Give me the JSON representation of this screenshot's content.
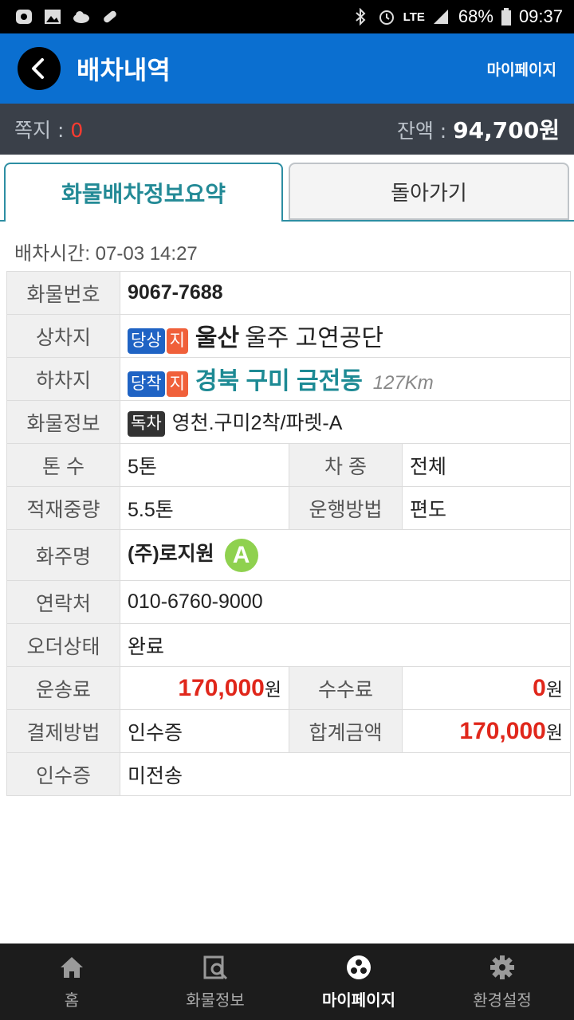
{
  "status_bar": {
    "battery": "68%",
    "time": "09:37",
    "network": "LTE"
  },
  "header": {
    "title": "배차내역",
    "mypage": "마이페이지"
  },
  "info_bar": {
    "note_label": "쪽지 : ",
    "note_count": "0",
    "balance_label": "잔액 : ",
    "balance_value": "94,700원"
  },
  "tabs": {
    "active": "화물배차정보요약",
    "back": "돌아가기"
  },
  "dispatch_time": "배차시간: 07-03 14:27",
  "details": {
    "cargo_no_label": "화물번호",
    "cargo_no": "9067-7688",
    "load_label": "상차지",
    "load_badge1": "당상",
    "load_badge2": "지",
    "load_city": "울산",
    "load_place": "울주 고연공단",
    "unload_label": "하차지",
    "unload_badge1": "당착",
    "unload_badge2": "지",
    "unload_place": "경북 구미 금전동",
    "distance": "127Km",
    "cargo_info_label": "화물정보",
    "cargo_info_badge": "독차",
    "cargo_info": "영천.구미2착/파렛-A",
    "ton_label": "톤 수",
    "ton": "5톤",
    "car_type_label": "차 종",
    "car_type": "전체",
    "weight_label": "적재중량",
    "weight": "5.5톤",
    "method_label": "운행방법",
    "method": "편도",
    "shipper_label": "화주명",
    "shipper": "(주)로지원",
    "shipper_grade": "A",
    "contact_label": "연락처",
    "contact": "010-6760-9000",
    "order_status_label": "오더상태",
    "order_status": "완료",
    "fare_label": "운송료",
    "fare": "170,000",
    "fee_label": "수수료",
    "fee": "0",
    "won": "원",
    "payment_label": "결제방법",
    "payment": "인수증",
    "total_label": "합계금액",
    "total": "170,000",
    "receipt_label": "인수증",
    "receipt": "미전송"
  },
  "bottom_nav": [
    {
      "label": "홈",
      "icon": "home-icon"
    },
    {
      "label": "화물정보",
      "icon": "search-doc-icon"
    },
    {
      "label": "마이페이지",
      "icon": "mypage-icon",
      "active": true
    },
    {
      "label": "환경설정",
      "icon": "gear-icon"
    }
  ]
}
